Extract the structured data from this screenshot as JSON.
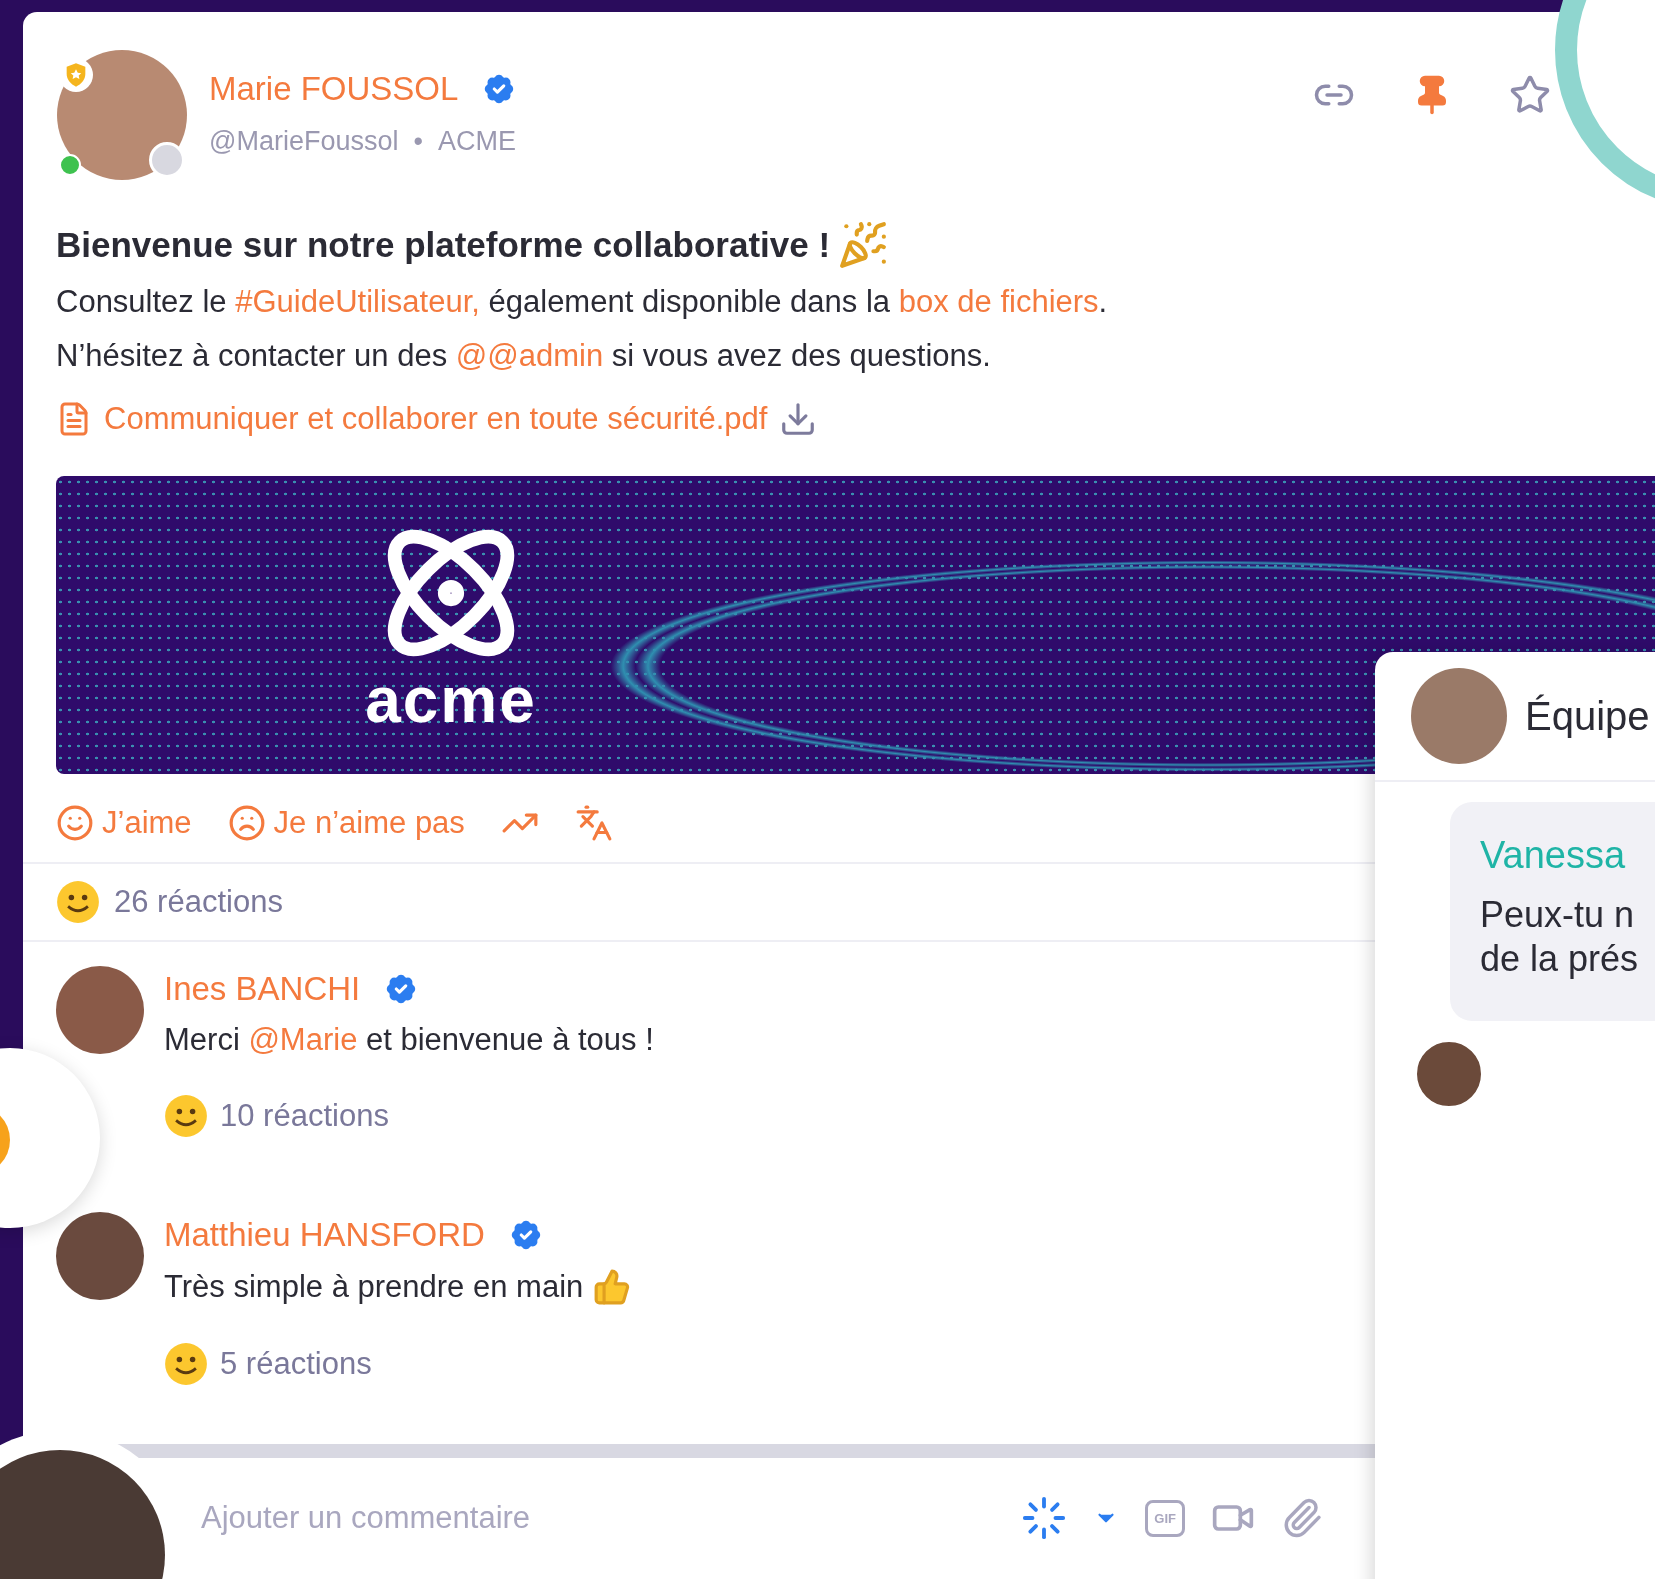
{
  "post": {
    "author": {
      "name": "Marie FOUSSOL",
      "verified": true,
      "admin": true,
      "online": true,
      "handle": "@MarieFoussol",
      "separator": "•",
      "organization": "ACME"
    },
    "toolbar": {
      "pinned": true,
      "starred": false
    },
    "title": "Bienvenue sur notre plateforme collaborative !",
    "paragraphs": [
      [
        {
          "kind": "text",
          "text": "Consultez le "
        },
        {
          "kind": "link",
          "text": "#GuideUtilisateur,"
        },
        {
          "kind": "text",
          "text": " également disponible dans la "
        },
        {
          "kind": "link",
          "text": "box de fichiers"
        },
        {
          "kind": "text",
          "text": "."
        }
      ],
      [
        {
          "kind": "text",
          "text": "N’hésitez à contacter un des "
        },
        {
          "kind": "link",
          "text": "@@admin"
        },
        {
          "kind": "text",
          "text": " si vous avez des questions."
        }
      ]
    ],
    "attachment": {
      "name": "Communiquer et collaborer en toute sécurité.pdf"
    },
    "banner": {
      "logo_text": "acme"
    },
    "actions": [
      {
        "kind": "like",
        "label": "J’aime"
      },
      {
        "kind": "dislike",
        "label": "Je n’aime pas"
      },
      {
        "kind": "stats"
      },
      {
        "kind": "translate"
      }
    ],
    "reactions": "26 réactions",
    "comments": [
      {
        "author": "Ines BANCHI",
        "verified": true,
        "segments": [
          {
            "kind": "text",
            "text": "Merci "
          },
          {
            "kind": "link",
            "text": "@Marie"
          },
          {
            "kind": "text",
            "text": " et bienvenue à tous !"
          }
        ],
        "thumbs_up": false,
        "reactions": "10 réactions"
      },
      {
        "author": "Matthieu HANSFORD",
        "verified": true,
        "segments": [
          {
            "kind": "text",
            "text": "Très simple à prendre en main"
          }
        ],
        "thumbs_up": true,
        "reactions": "5 réactions"
      }
    ],
    "composer": {
      "placeholder": "Ajouter un commentaire",
      "gif_label": "GIF"
    }
  },
  "side_panel": {
    "title": "Équipe",
    "message": {
      "author": "Vanessa",
      "lines": [
        "Peux-tu n",
        "de la prés"
      ]
    }
  }
}
